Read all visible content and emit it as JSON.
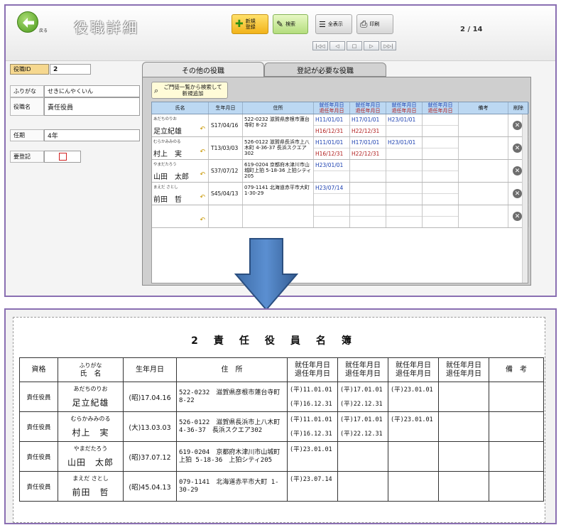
{
  "screen": {
    "back_label": "戻る",
    "title": "役職詳細",
    "buttons": {
      "new": "新規\n登録",
      "search": "検索",
      "show_all": "全表示",
      "print": "印刷"
    },
    "page_indicator": "2 / 14",
    "pager": [
      "|◁◁",
      "◁",
      "□",
      "▷",
      "▷▷|"
    ]
  },
  "form": {
    "id_label": "役職ID",
    "id_value": "2",
    "furigana_label": "ふりがな",
    "furigana_value": "せきにんやくいん",
    "name_label": "役職名",
    "name_value": "責任役員",
    "term_label": "任期",
    "term_value": "4年",
    "registration_label": "要登記"
  },
  "tabs": [
    {
      "label": "その他の役職",
      "active": true
    },
    {
      "label": "登記が必要な役職",
      "active": false
    }
  ],
  "subform": {
    "search_button": "ご門徒一覧から検索して\n新規追加",
    "headers": {
      "name": "氏名",
      "dob": "生年月日",
      "address": "住所",
      "period_start": "就任年月日",
      "period_end": "退任年月日",
      "note": "備考",
      "delete": "削除"
    },
    "rows": [
      {
        "kana": "あだちのりお",
        "name": "足立紀雄",
        "dob": "S17/04/16",
        "address": "522-0232 滋賀県彦根市蓮台寺町 8-22",
        "periods": [
          [
            "H11/01/01",
            "H16/12/31"
          ],
          [
            "H17/01/01",
            "H22/12/31"
          ],
          [
            "H23/01/01",
            ""
          ],
          [
            "",
            ""
          ]
        ]
      },
      {
        "kana": "むらかみみのる",
        "name": "村上　実",
        "dob": "T13/03/03",
        "address": "526-0122 滋賀県長浜市上八木町 4-36-37 長浜スクエア302",
        "periods": [
          [
            "H11/01/01",
            "H16/12/31"
          ],
          [
            "H17/01/01",
            "H22/12/31"
          ],
          [
            "H23/01/01",
            ""
          ],
          [
            "",
            ""
          ]
        ]
      },
      {
        "kana": "やまだたろう",
        "name": "山田　太郎",
        "dob": "S37/07/12",
        "address": "619-0204 京都府木津川市山城町上狛 5-18-36 上狛シティ205",
        "periods": [
          [
            "H23/01/01",
            ""
          ],
          [
            "",
            ""
          ],
          [
            "",
            ""
          ],
          [
            "",
            ""
          ]
        ]
      },
      {
        "kana": "まえだ さとし",
        "name": "前田　哲",
        "dob": "S45/04/13",
        "address": "079-1141 北海道赤平市大町 1-30-29",
        "periods": [
          [
            "H23/07/14",
            ""
          ],
          [
            "",
            ""
          ],
          [
            "",
            ""
          ],
          [
            "",
            ""
          ]
        ]
      }
    ]
  },
  "report": {
    "title_number": "2",
    "title_text": "責任役員名簿",
    "headers": {
      "rank": "資格",
      "name_kana": "ふりがな",
      "name": "氏　名",
      "dob": "生年月日",
      "address": "住　所",
      "period_start": "就任年月日",
      "period_end": "退任年月日",
      "note": "備　考"
    },
    "rows": [
      {
        "rank": "責任役員",
        "kana": "あだちのりお",
        "name": "足立紀雄",
        "dob": "(昭)17.04.16",
        "address": "522-0232　滋賀県彦根市蓮台寺町 8-22",
        "periods": [
          [
            "(平)11.01.01",
            "(平)16.12.31"
          ],
          [
            "(平)17.01.01",
            "(平)22.12.31"
          ],
          [
            "(平)23.01.01",
            ""
          ],
          [
            "",
            ""
          ]
        ]
      },
      {
        "rank": "責任役員",
        "kana": "むらかみみのる",
        "name": "村上　実",
        "dob": "(大)13.03.03",
        "address": "526-0122　滋賀県長浜市上八木町 4-36-37　長浜スクエア302",
        "periods": [
          [
            "(平)11.01.01",
            "(平)16.12.31"
          ],
          [
            "(平)17.01.01",
            "(平)22.12.31"
          ],
          [
            "(平)23.01.01",
            ""
          ],
          [
            "",
            ""
          ]
        ]
      },
      {
        "rank": "責任役員",
        "kana": "やまだたろう",
        "name": "山田　太郎",
        "dob": "(昭)37.07.12",
        "address": "619-0204　京都府木津川市山城町上狛 5-18-36　上狛シティ205",
        "periods": [
          [
            "(平)23.01.01",
            ""
          ],
          [
            "",
            ""
          ],
          [
            "",
            ""
          ],
          [
            "",
            ""
          ]
        ]
      },
      {
        "rank": "責任役員",
        "kana": "まえだ さとし",
        "name": "前田　哲",
        "dob": "(昭)45.04.13",
        "address": "079-1141　北海道赤平市大町 1-30-29",
        "periods": [
          [
            "(平)23.07.14",
            ""
          ],
          [
            "",
            ""
          ],
          [
            "",
            ""
          ],
          [
            "",
            ""
          ]
        ]
      }
    ]
  }
}
